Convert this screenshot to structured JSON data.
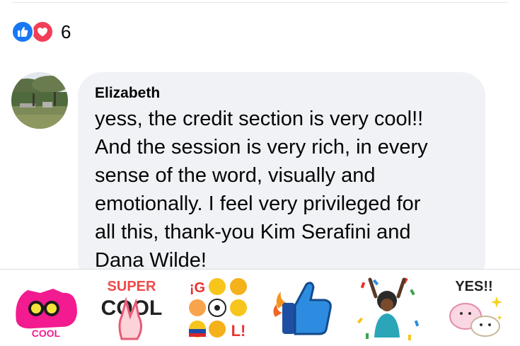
{
  "reactions": {
    "icons": [
      "like-icon",
      "love-icon"
    ],
    "count": "6",
    "colors": {
      "like": "#1877f2",
      "love": "#f33e58"
    }
  },
  "comment": {
    "author": "Elizabeth",
    "text": "yess, the credit section is very cool!!\nAnd the session is very rich, in every\nsense of the word, visually and\nemotionally.  I feel very privileged for\nall this, thank-you Kim Serafini  and\nDana Wilde!"
  },
  "sticker_tray": {
    "stickers": [
      {
        "name": "cool-sticker",
        "label": "COOL"
      },
      {
        "name": "super-cool-sticker",
        "label_top": "SUPER",
        "label_bottom": "COOL"
      },
      {
        "name": "goool-sticker",
        "label_top": "¡G",
        "label_bottom": "L!"
      },
      {
        "name": "thumbs-up-sticker"
      },
      {
        "name": "celebration-sticker"
      },
      {
        "name": "yes-sticker",
        "label": "YES!!"
      }
    ]
  }
}
